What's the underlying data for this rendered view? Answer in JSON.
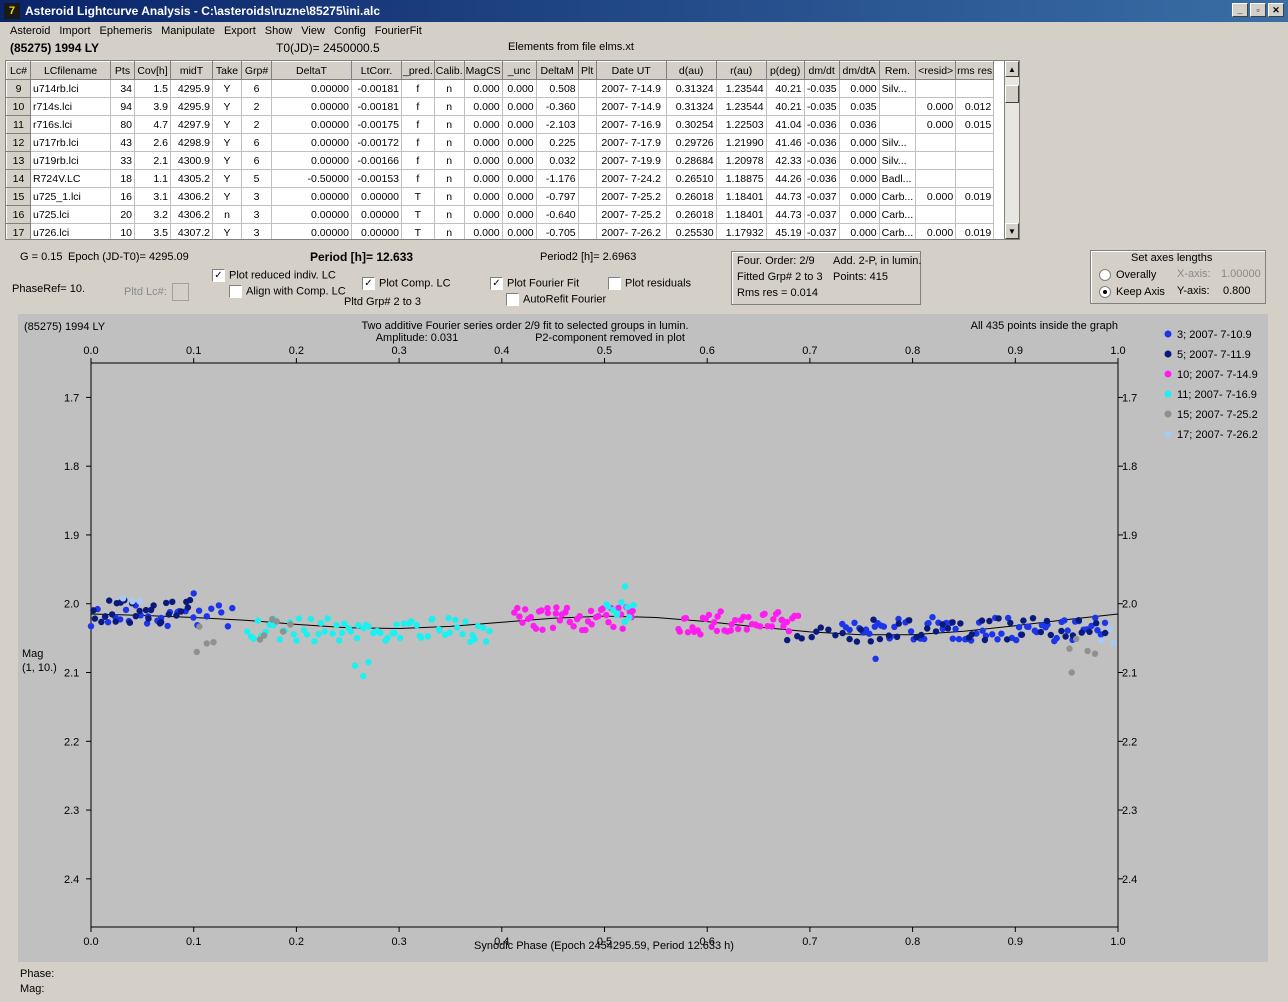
{
  "window": {
    "title": "Asteroid Lightcurve Analysis - C:\\asteroids\\ruzne\\85275\\ini.alc"
  },
  "menu": [
    "Asteroid",
    "Import",
    "Ephemeris",
    "Manipulate",
    "Export",
    "Show",
    "View",
    "Config",
    "FourierFit"
  ],
  "header": {
    "asteroid": "(85275) 1994 LY",
    "t0": "T0(JD)= 2450000.5",
    "elements": "Elements from file elms.xt"
  },
  "table": {
    "columns": [
      "Lc#",
      "LCfilename",
      "Pts",
      "Cov[h]",
      "midT",
      "Take",
      "Grp#",
      "DeltaT",
      "LtCorr.",
      "_pred.",
      "Calib.",
      "MagCS",
      "_unc",
      "DeltaM",
      "Plt",
      "Date UT",
      "d(au)",
      "r(au)",
      "p(deg)",
      "dm/dt",
      "dm/dtA",
      "Rem.",
      "<resid>",
      "rms res"
    ],
    "rows": [
      [
        "9",
        "u714rb.lci",
        "34",
        "1.5",
        "4295.9",
        "Y",
        "6",
        "0.00000",
        "-0.00181",
        "f",
        "n",
        "0.000",
        "0.000",
        "0.508",
        "",
        "2007- 7-14.9",
        "0.31324",
        "1.23544",
        "40.21",
        "-0.035",
        "0.000",
        "Silv...",
        "",
        ""
      ],
      [
        "10",
        "r714s.lci",
        "94",
        "3.9",
        "4295.9",
        "Y",
        "2",
        "0.00000",
        "-0.00181",
        "f",
        "n",
        "0.000",
        "0.000",
        "-0.360",
        "",
        "2007- 7-14.9",
        "0.31324",
        "1.23544",
        "40.21",
        "-0.035",
        "0.035",
        "",
        "0.000",
        "0.012"
      ],
      [
        "11",
        "r716s.lci",
        "80",
        "4.7",
        "4297.9",
        "Y",
        "2",
        "0.00000",
        "-0.00175",
        "f",
        "n",
        "0.000",
        "0.000",
        "-2.103",
        "",
        "2007- 7-16.9",
        "0.30254",
        "1.22503",
        "41.04",
        "-0.036",
        "0.036",
        "",
        "0.000",
        "0.015"
      ],
      [
        "12",
        "u717rb.lci",
        "43",
        "2.6",
        "4298.9",
        "Y",
        "6",
        "0.00000",
        "-0.00172",
        "f",
        "n",
        "0.000",
        "0.000",
        "0.225",
        "",
        "2007- 7-17.9",
        "0.29726",
        "1.21990",
        "41.46",
        "-0.036",
        "0.000",
        "Silv...",
        "",
        ""
      ],
      [
        "13",
        "u719rb.lci",
        "33",
        "2.1",
        "4300.9",
        "Y",
        "6",
        "0.00000",
        "-0.00166",
        "f",
        "n",
        "0.000",
        "0.000",
        "0.032",
        "",
        "2007- 7-19.9",
        "0.28684",
        "1.20978",
        "42.33",
        "-0.036",
        "0.000",
        "Silv...",
        "",
        ""
      ],
      [
        "14",
        "R724V.LC",
        "18",
        "1.1",
        "4305.2",
        "Y",
        "5",
        "-0.50000",
        "-0.00153",
        "f",
        "n",
        "0.000",
        "0.000",
        "-1.176",
        "",
        "2007- 7-24.2",
        "0.26510",
        "1.18875",
        "44.26",
        "-0.036",
        "0.000",
        "Badl...",
        "",
        ""
      ],
      [
        "15",
        "u725_1.lci",
        "16",
        "3.1",
        "4306.2",
        "Y",
        "3",
        "0.00000",
        "0.00000",
        "T",
        "n",
        "0.000",
        "0.000",
        "-0.797",
        "",
        "2007- 7-25.2",
        "0.26018",
        "1.18401",
        "44.73",
        "-0.037",
        "0.000",
        "Carb...",
        "0.000",
        "0.019"
      ],
      [
        "16",
        "u725.lci",
        "20",
        "3.2",
        "4306.2",
        "n",
        "3",
        "0.00000",
        "0.00000",
        "T",
        "n",
        "0.000",
        "0.000",
        "-0.640",
        "",
        "2007- 7-25.2",
        "0.26018",
        "1.18401",
        "44.73",
        "-0.037",
        "0.000",
        "Carb...",
        "",
        ""
      ],
      [
        "17",
        "u726.lci",
        "10",
        "3.5",
        "4307.2",
        "Y",
        "3",
        "0.00000",
        "0.00000",
        "T",
        "n",
        "0.000",
        "0.000",
        "-0.705",
        "",
        "2007- 7-26.2",
        "0.25530",
        "1.17932",
        "45.19",
        "-0.037",
        "0.000",
        "Carb...",
        "0.000",
        "0.019"
      ]
    ]
  },
  "controls": {
    "g": "G = 0.15",
    "epoch": "Epoch (JD-T0)= 4295.09",
    "phase_ref": "PhaseRef= 10.",
    "pltd_lc": "Pltd Lc#:",
    "period": "Period [h]= 12.633",
    "period2": "Period2 [h]= 2.6963",
    "plot_reduced": "Plot reduced indiv. LC",
    "align_comp": "Align with Comp. LC",
    "plot_comp": "Plot Comp. LC",
    "pltd_grp": "Pltd Grp#  2   to   3",
    "plot_fourier": "Plot Fourier Fit",
    "autorefit": "AutoRefit Fourier",
    "plot_resid": "Plot residuals",
    "four_order": "Four. Order:  2/9",
    "add_2p": "Add. 2-P, in lumin.",
    "fitted_grp": "Fitted Grp# 2 to 3",
    "points": "Points: 415",
    "rms_res": "Rms res     = 0.014",
    "axes_title": "Set axes lengths",
    "overally": "Overally",
    "keep_axis": "Keep Axis",
    "x_axis_label": "X-axis:",
    "x_axis_value": "1.00000",
    "y_axis_label": "Y-axis:",
    "y_axis_value": "0.800"
  },
  "check_icon": "✓",
  "chart_data": {
    "type": "scatter",
    "corner_label": "(85275) 1994 LY",
    "title_line1": "Two additive Fourier series order 2/9 fit to selected groups in lumin.",
    "amplitude": "Amplitude: 0.031",
    "p2_note": "P2-component removed in plot",
    "points_note": "All 435 points inside the graph",
    "xlabel": "Synodic Phase (Epoch 2454295.59, Period 12.633 h)",
    "ylabel": "Mag",
    "ylabel2": "(1, 10.)",
    "xlim": [
      0,
      1
    ],
    "ylim": [
      2.47,
      1.65
    ],
    "x_ticks": [
      "0.0",
      "0.1",
      "0.2",
      "0.3",
      "0.4",
      "0.5",
      "0.6",
      "0.7",
      "0.8",
      "0.9",
      "1.0"
    ],
    "y_ticks": [
      "1.7",
      "1.8",
      "1.9",
      "2.0",
      "2.1",
      "2.2",
      "2.3",
      "2.4"
    ],
    "fit": {
      "x": [
        0.0,
        0.05,
        0.1,
        0.15,
        0.2,
        0.25,
        0.3,
        0.35,
        0.4,
        0.45,
        0.5,
        0.55,
        0.6,
        0.65,
        0.7,
        0.75,
        0.8,
        0.85,
        0.9,
        0.95,
        1.0
      ],
      "y": [
        2.015,
        2.017,
        2.02,
        2.024,
        2.03,
        2.035,
        2.036,
        2.033,
        2.027,
        2.021,
        2.018,
        2.02,
        2.026,
        2.034,
        2.041,
        2.045,
        2.045,
        2.04,
        2.032,
        2.023,
        2.015
      ]
    },
    "series": [
      {
        "name": "3; 2007- 7-10.9",
        "color": "#1d35e8",
        "segments": [
          {
            "from": 0.0,
            "to": 0.14,
            "y": 2.018,
            "n": 28
          },
          {
            "from": 0.73,
            "to": 0.99,
            "y": 2.037,
            "n": 70
          }
        ]
      },
      {
        "name": "5; 2007- 7-11.9",
        "color": "#0a1a7a",
        "segments": [
          {
            "from": 0.0,
            "to": 0.1,
            "y": 2.012,
            "n": 28
          },
          {
            "from": 0.67,
            "to": 0.99,
            "y": 2.038,
            "n": 50
          }
        ]
      },
      {
        "name": "10; 2007- 7-14.9",
        "color": "#ff1cf0",
        "segments": [
          {
            "from": 0.41,
            "to": 0.53,
            "y": 2.022,
            "n": 45
          },
          {
            "from": 0.57,
            "to": 0.69,
            "y": 2.028,
            "n": 45
          }
        ]
      },
      {
        "name": "11; 2007- 7-16.9",
        "color": "#1cf0f0",
        "segments": [
          {
            "from": 0.15,
            "to": 0.39,
            "y": 2.038,
            "n": 70
          },
          {
            "from": 0.5,
            "to": 0.53,
            "y": 2.015,
            "n": 10
          }
        ]
      },
      {
        "name": "15; 2007- 7-25.2",
        "color": "#909090",
        "segments": [
          {
            "from": 0.1,
            "to": 0.12,
            "y": 2.05,
            "n": 3
          },
          {
            "from": 0.16,
            "to": 0.2,
            "y": 2.04,
            "n": 6
          },
          {
            "from": 0.95,
            "to": 0.98,
            "y": 2.06,
            "n": 4
          }
        ]
      },
      {
        "name": "17; 2007- 7-26.2",
        "color": "#a8c8f8",
        "segments": [
          {
            "from": 0.03,
            "to": 0.05,
            "y": 2.0,
            "n": 3
          },
          {
            "from": 0.98,
            "to": 1.0,
            "y": 2.04,
            "n": 3
          }
        ]
      }
    ],
    "outliers": [
      {
        "x": 0.265,
        "y": 2.105,
        "s": 3
      },
      {
        "x": 0.257,
        "y": 2.09,
        "s": 3
      },
      {
        "x": 0.27,
        "y": 2.085,
        "s": 3
      },
      {
        "x": 0.103,
        "y": 2.07,
        "s": 4
      },
      {
        "x": 0.955,
        "y": 2.1,
        "s": 4
      },
      {
        "x": 0.52,
        "y": 1.975,
        "s": 3
      },
      {
        "x": 0.1,
        "y": 1.985,
        "s": 0
      },
      {
        "x": 0.764,
        "y": 2.08,
        "s": 0
      }
    ]
  },
  "status": {
    "phase": "Phase:",
    "mag": "Mag:"
  }
}
